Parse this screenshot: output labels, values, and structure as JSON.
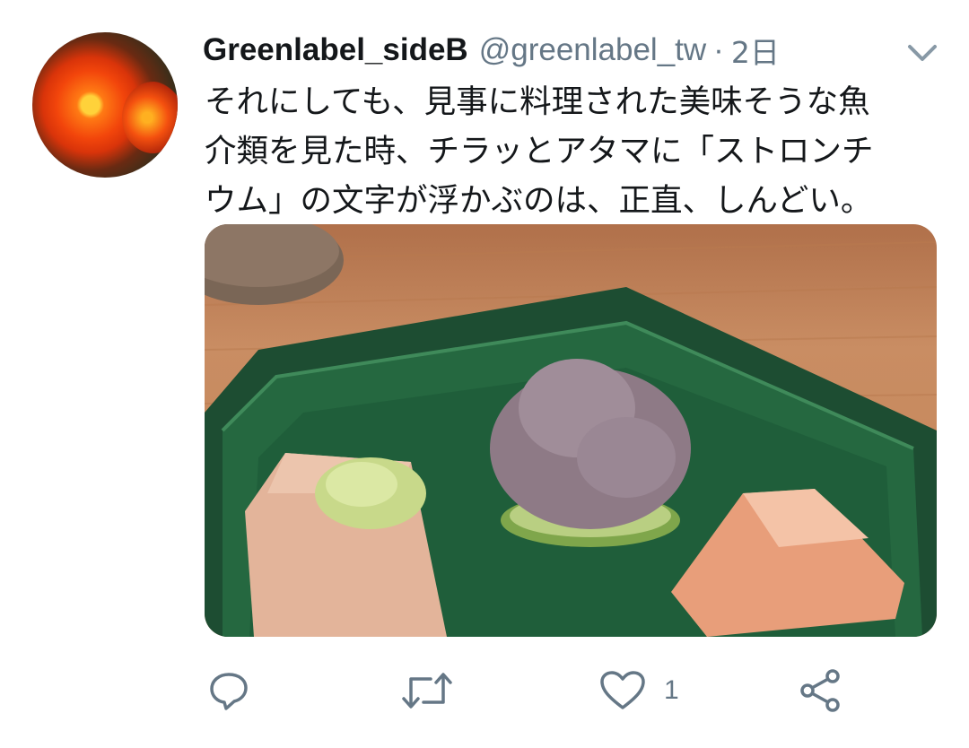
{
  "tweet": {
    "display_name": "Greenlabel_sideB",
    "handle": "@greenlabel_tw",
    "separator": "·",
    "time": "2日",
    "text_lines": [
      "それにしても、見事に料理された美味そうな魚",
      "介類を見た時、チラッとアタマに「ストロンチ",
      "ウム」の文字が浮かぶのは、正直、しんどい。"
    ],
    "like_count": "1"
  },
  "icons": {
    "menu": "chevron-down-icon",
    "reply": "reply-icon",
    "retweet": "retweet-icon",
    "like": "heart-icon",
    "share": "share-icon"
  },
  "colors": {
    "text": "#14171a",
    "secondary": "#657786",
    "plate_green": "#1f5a3a"
  }
}
